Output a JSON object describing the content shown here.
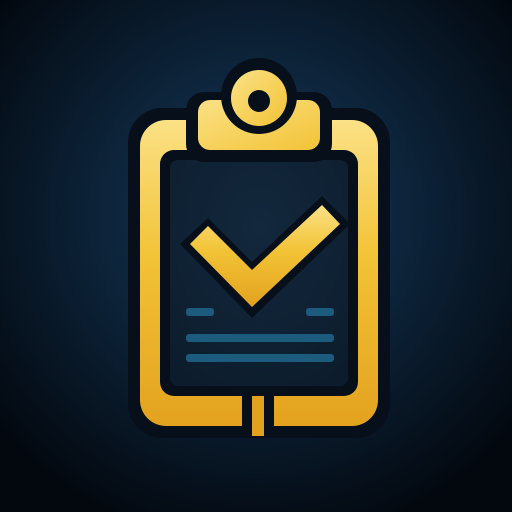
{
  "icon": {
    "name": "clipboard-check-icon",
    "colors": {
      "background_center": "#163c5c",
      "background_edge": "#03080f",
      "gold_light": "#fbe186",
      "gold": "#f2c336",
      "gold_dark": "#e3a21e",
      "board_dark": "#0c1c2c",
      "outline": "#07101a",
      "line_teal": "#1c5a7e"
    }
  }
}
